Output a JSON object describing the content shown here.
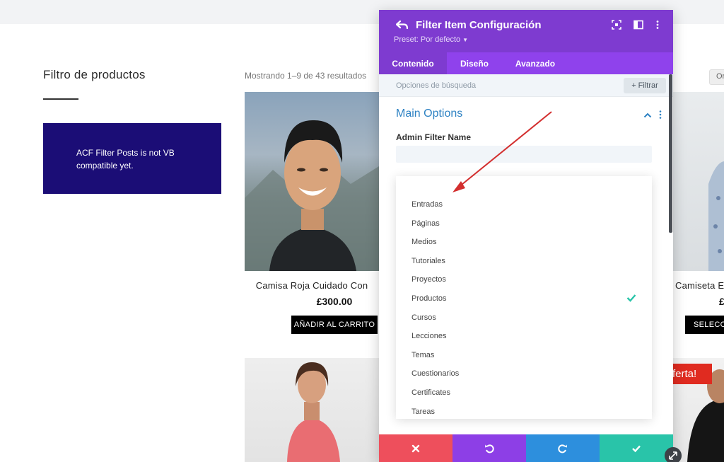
{
  "sidebar": {
    "title": "Filtro de productos",
    "notice": "ACF Filter Posts is not VB compatible yet."
  },
  "shop": {
    "results": "Mostrando 1–9 de 43 resultados",
    "sort_value": "Or",
    "products": [
      {
        "name": "Camisa Roja Cuidado Con",
        "price": "£300.00",
        "button": "AÑADIR AL CARRITO"
      },
      {
        "name": "Camiseta E",
        "price": "£",
        "button": "SELECCIO"
      }
    ],
    "sale_badge": "ferta!"
  },
  "panel": {
    "title": "Filter Item Configuración",
    "preset": "Preset: Por defecto",
    "tabs": [
      "Contenido",
      "Diseño",
      "Avanzado"
    ],
    "active_tab": "Contenido",
    "search_placeholder": "Opciones de búsqueda",
    "filter_button": "+ Filtrar",
    "section_title": "Main Options",
    "field_label": "Admin Filter Name",
    "field_value": "",
    "options": [
      "Entradas",
      "Páginas",
      "Medios",
      "Tutoriales",
      "Proyectos",
      "Productos",
      "Cursos",
      "Lecciones",
      "Temas",
      "Cuestionarios",
      "Certificates",
      "Tareas"
    ],
    "selected_option": "Productos",
    "icons": {
      "back": "back-arrow-icon",
      "header": [
        "focus-icon",
        "split-view-icon",
        "more-icon"
      ],
      "section": [
        "chevron-up-icon",
        "kebab-icon"
      ],
      "check": "checkmark-icon",
      "actions": [
        "close-icon",
        "undo-icon",
        "redo-icon",
        "save-check-icon"
      ]
    },
    "colors": {
      "header": "#7e3bd0",
      "tabs": "#8f42ec",
      "section_title": "#2e82c3",
      "cancel": "#ee4f5c",
      "undo": "#8d3fe6",
      "redo": "#2d8fdd",
      "save": "#29c4a9",
      "check": "#29c4a9",
      "annotation_arrow": "#d32f2f"
    }
  }
}
